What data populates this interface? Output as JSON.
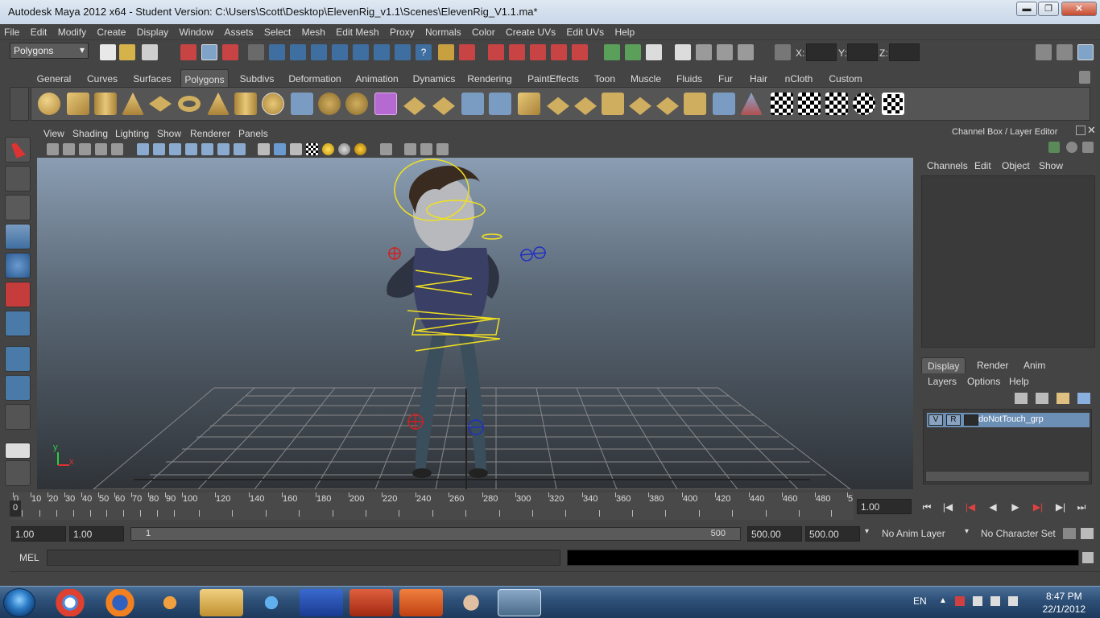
{
  "window": {
    "title": "Autodesk Maya 2012 x64 - Student Version: C:\\Users\\Scott\\Desktop\\ElevenRig_v1.1\\Scenes\\ElevenRig_V1.1.ma*",
    "minimize": "▬",
    "maximize": "❐",
    "close": "✕"
  },
  "menubar": [
    "File",
    "Edit",
    "Modify",
    "Create",
    "Display",
    "Window",
    "Assets",
    "Select",
    "Mesh",
    "Edit Mesh",
    "Proxy",
    "Normals",
    "Color",
    "Create UVs",
    "Edit UVs",
    "Help"
  ],
  "statusline": {
    "menuset": "Polygons",
    "x_label": "X:",
    "y_label": "Y:",
    "z_label": "Z:"
  },
  "shelf_tabs": [
    "General",
    "Curves",
    "Surfaces",
    "Polygons",
    "Subdivs",
    "Deformation",
    "Animation",
    "Dynamics",
    "Rendering",
    "PaintEffects",
    "Toon",
    "Muscle",
    "Fluids",
    "Fur",
    "Hair",
    "nCloth",
    "Custom"
  ],
  "shelf_active": "Polygons",
  "viewport_menu": [
    "View",
    "Shading",
    "Lighting",
    "Show",
    "Renderer",
    "Panels"
  ],
  "axis": {
    "y": "y",
    "x": "x"
  },
  "channel_box": {
    "title": "Channel Box / Layer Editor",
    "menu": [
      "Channels",
      "Edit",
      "Object",
      "Show"
    ]
  },
  "layer_editor": {
    "tabs": [
      "Display",
      "Render",
      "Anim"
    ],
    "active_tab": "Display",
    "menu": [
      "Layers",
      "Options",
      "Help"
    ],
    "layer": {
      "v": "V",
      "r": "R",
      "name": "doNotTouch_grp"
    }
  },
  "time_slider": {
    "ticks": [
      "0",
      "10",
      "20",
      "30",
      "40",
      "50",
      "60",
      "70",
      "80",
      "90",
      "100",
      "120",
      "140",
      "160",
      "180",
      "200",
      "220",
      "240",
      "260",
      "280",
      "300",
      "320",
      "340",
      "360",
      "380",
      "400",
      "420",
      "440",
      "460",
      "480",
      "5"
    ],
    "current_frame": "1.00",
    "frame_marker": "0"
  },
  "range_slider": {
    "start": "1.00",
    "start2": "1.00",
    "range_start": "1",
    "range_end": "500",
    "end": "500.00",
    "end2": "500.00",
    "anim_layer": "No Anim Layer",
    "char_set": "No Character Set"
  },
  "command_line": {
    "label": "MEL"
  },
  "taskbar": {
    "lang": "EN",
    "time": "8:47 PM",
    "date": "22/1/2012"
  }
}
